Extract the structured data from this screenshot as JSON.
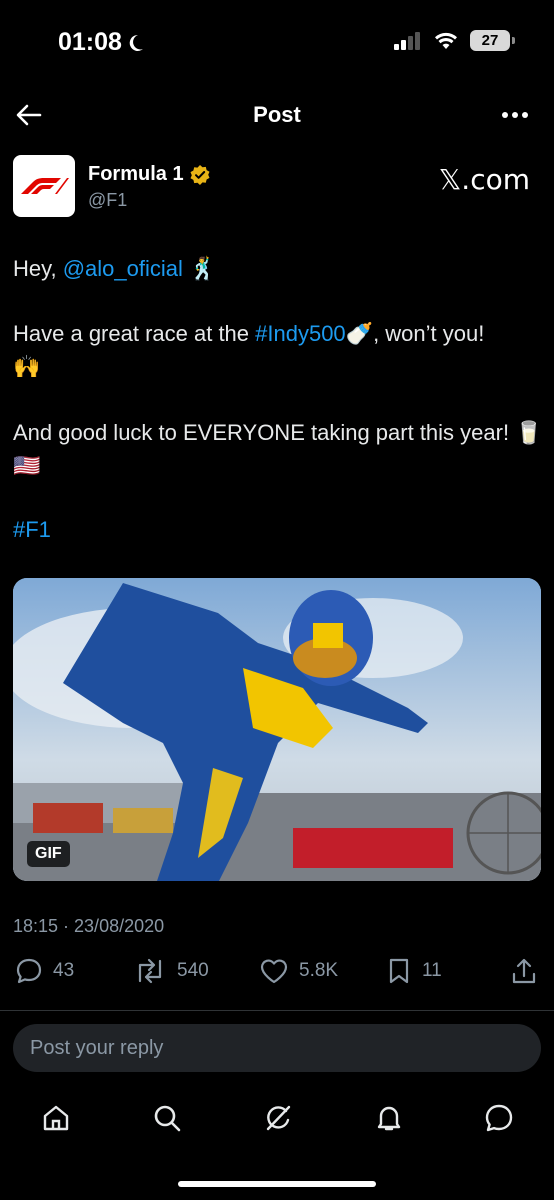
{
  "status_bar": {
    "time": "01:08",
    "battery": "27"
  },
  "header": {
    "title": "Post"
  },
  "author": {
    "name": "Formula 1",
    "handle": "@F1"
  },
  "watermark": "𝕏.com",
  "post": {
    "line1_prefix": "Hey, ",
    "mention": "@alo_oficial",
    "line1_emoji": "🕺",
    "line2_prefix": "Have a great race at the ",
    "hashtag_indy": "#Indy500",
    "line2_suffix": "🍼, won’t you!",
    "line2_emoji": "🙌",
    "line3": "And good luck to EVERYONE taking part this year! 🥛🇺🇸",
    "hashtag_f1": "#F1"
  },
  "media": {
    "badge": "GIF"
  },
  "timestamp": "18:15 · 23/08/2020",
  "actions": {
    "replies": "43",
    "reposts": "540",
    "likes": "5.8K",
    "bookmarks": "11"
  },
  "reply": {
    "placeholder": "Post your reply"
  },
  "colors": {
    "background": "#000000",
    "link": "#1d9bf0",
    "muted": "#8b98a5",
    "verified": "#e8b416"
  }
}
